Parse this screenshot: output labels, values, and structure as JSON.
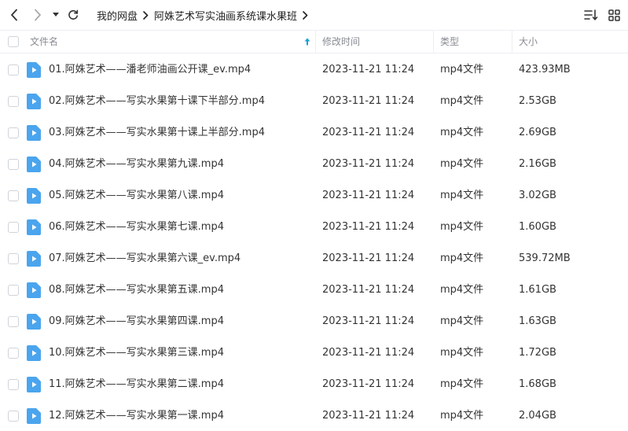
{
  "toolbar": {
    "back_icon": "chevron-left-icon",
    "forward_icon": "chevron-right-icon",
    "history_icon": "caret-down-icon",
    "refresh_icon": "refresh-icon",
    "sort_icon": "sort-list-icon",
    "grid_icon": "grid-view-icon"
  },
  "breadcrumb": [
    "我的网盘",
    "阿姝艺术写实油画系统课水果班"
  ],
  "columns": {
    "name": "文件名",
    "modified": "修改时间",
    "type": "类型",
    "size": "大小"
  },
  "colors": {
    "file_icon": "#4aa5ee",
    "sort_arrow": "#1aa1d6"
  },
  "files": [
    {
      "name": "01.阿姝艺术——潘老师油画公开课_ev.mp4",
      "modified": "2023-11-21 11:24",
      "type": "mp4文件",
      "size": "423.93MB"
    },
    {
      "name": "02.阿姝艺术——写实水果第十课下半部分.mp4",
      "modified": "2023-11-21 11:24",
      "type": "mp4文件",
      "size": "2.53GB"
    },
    {
      "name": "03.阿姝艺术——写实水果第十课上半部分.mp4",
      "modified": "2023-11-21 11:24",
      "type": "mp4文件",
      "size": "2.69GB"
    },
    {
      "name": "04.阿姝艺术——写实水果第九课.mp4",
      "modified": "2023-11-21 11:24",
      "type": "mp4文件",
      "size": "2.16GB"
    },
    {
      "name": "05.阿姝艺术——写实水果第八课.mp4",
      "modified": "2023-11-21 11:24",
      "type": "mp4文件",
      "size": "3.02GB"
    },
    {
      "name": "06.阿姝艺术——写实水果第七课.mp4",
      "modified": "2023-11-21 11:24",
      "type": "mp4文件",
      "size": "1.60GB"
    },
    {
      "name": "07.阿姝艺术——写实水果第六课_ev.mp4",
      "modified": "2023-11-21 11:24",
      "type": "mp4文件",
      "size": "539.72MB"
    },
    {
      "name": "08.阿姝艺术——写实水果第五课.mp4",
      "modified": "2023-11-21 11:24",
      "type": "mp4文件",
      "size": "1.61GB"
    },
    {
      "name": "09.阿姝艺术——写实水果第四课.mp4",
      "modified": "2023-11-21 11:24",
      "type": "mp4文件",
      "size": "1.63GB"
    },
    {
      "name": "10.阿姝艺术——写实水果第三课.mp4",
      "modified": "2023-11-21 11:24",
      "type": "mp4文件",
      "size": "1.72GB"
    },
    {
      "name": "11.阿姝艺术——写实水果第二课.mp4",
      "modified": "2023-11-21 11:24",
      "type": "mp4文件",
      "size": "1.68GB"
    },
    {
      "name": "12.阿姝艺术——写实水果第一课.mp4",
      "modified": "2023-11-21 11:24",
      "type": "mp4文件",
      "size": "2.04GB"
    }
  ]
}
